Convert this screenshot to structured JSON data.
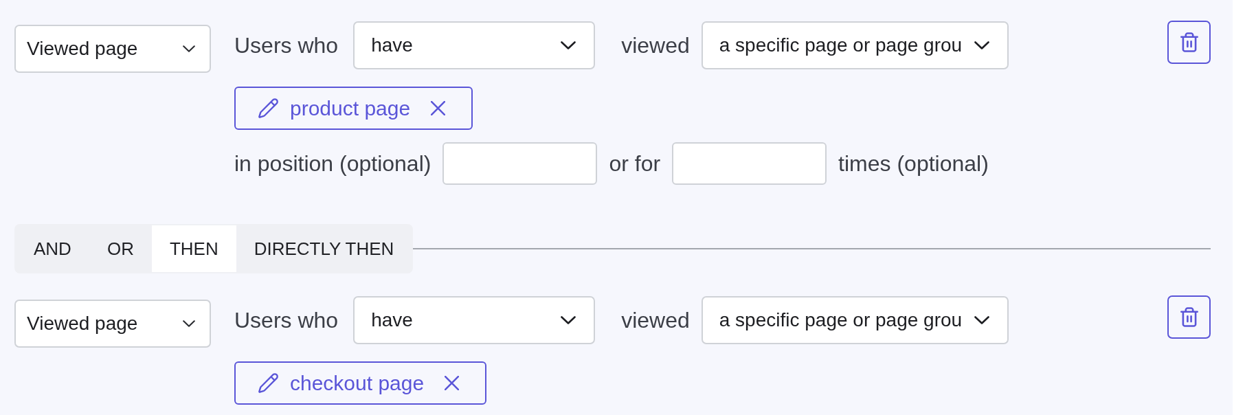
{
  "steps": [
    {
      "kind": "condition",
      "event": "Viewed page",
      "subject_label": "Users who",
      "qualifier": "have",
      "verb_label": "viewed",
      "scope": "a specific page or page grou",
      "pages": [
        {
          "label": "product page"
        }
      ],
      "extra": [
        {
          "kind": "label",
          "text": "in position (optional)"
        },
        {
          "kind": "input"
        },
        {
          "kind": "label",
          "text": "or for"
        },
        {
          "kind": "input"
        },
        {
          "kind": "label",
          "text": "times (optional)"
        }
      ]
    },
    {
      "kind": "operator",
      "options": [
        {
          "label": "AND",
          "selected": false
        },
        {
          "label": "OR",
          "selected": false
        },
        {
          "label": "THEN",
          "selected": true
        },
        {
          "label": "DIRECTLY THEN",
          "selected": false
        }
      ]
    },
    {
      "kind": "condition",
      "event": "Viewed page",
      "subject_label": "Users who",
      "qualifier": "have",
      "verb_label": "viewed",
      "scope": "a specific page or page grou",
      "pages": [
        {
          "label": "checkout page"
        }
      ]
    }
  ]
}
